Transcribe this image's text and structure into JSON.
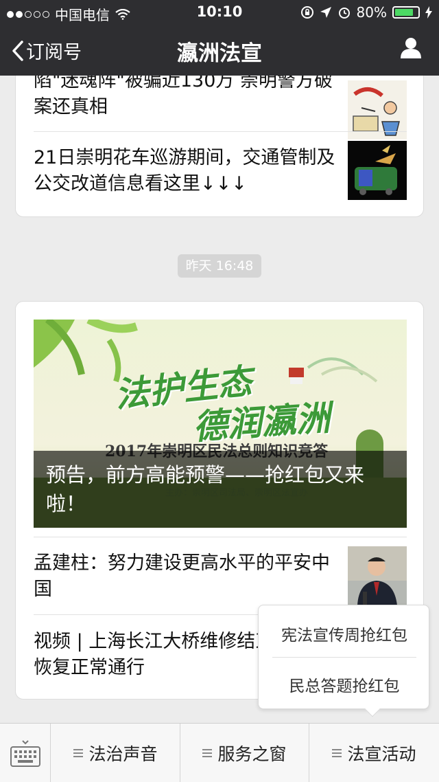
{
  "status_bar": {
    "carrier": "中国电信",
    "time": "10:10",
    "battery": "80%",
    "battery_level": 0.8
  },
  "nav": {
    "back_label": "订阅号",
    "title": "瀛洲法宣"
  },
  "card1": {
    "items": [
      {
        "title": "陷\"迷魂阵\"被骗近130万 崇明警方破案还真相"
      },
      {
        "title": "21日崇明花车巡游期间，交通管制及公交改道信息看这里↓↓↓"
      }
    ]
  },
  "timestamp": "昨天 16:48",
  "card2": {
    "banner": {
      "logo_line1": "法护生态",
      "logo_line2": "德润瀛洲",
      "subtitle": "2017年崇明区民法总则知识竞答",
      "host": "主办：崇明区司法局、崇明区法宣办",
      "title": "预告，前方高能预警——抢红包又来啦！"
    },
    "items": [
      {
        "title": "孟建柱：努力建设更高水平的平安中国"
      },
      {
        "title": "视频 | 上海长江大桥维修结束，明天恢复正常通行"
      }
    ]
  },
  "popup_menu": {
    "options": [
      "宪法宣传周抢红包",
      "民总答题抢红包"
    ]
  },
  "bottom_menu": {
    "buttons": [
      "法治声音",
      "服务之窗",
      "法宣活动"
    ]
  },
  "colors": {
    "nav_bg": "#2e2e31",
    "battery_green": "#4cd964",
    "page_bg": "#ececec"
  }
}
